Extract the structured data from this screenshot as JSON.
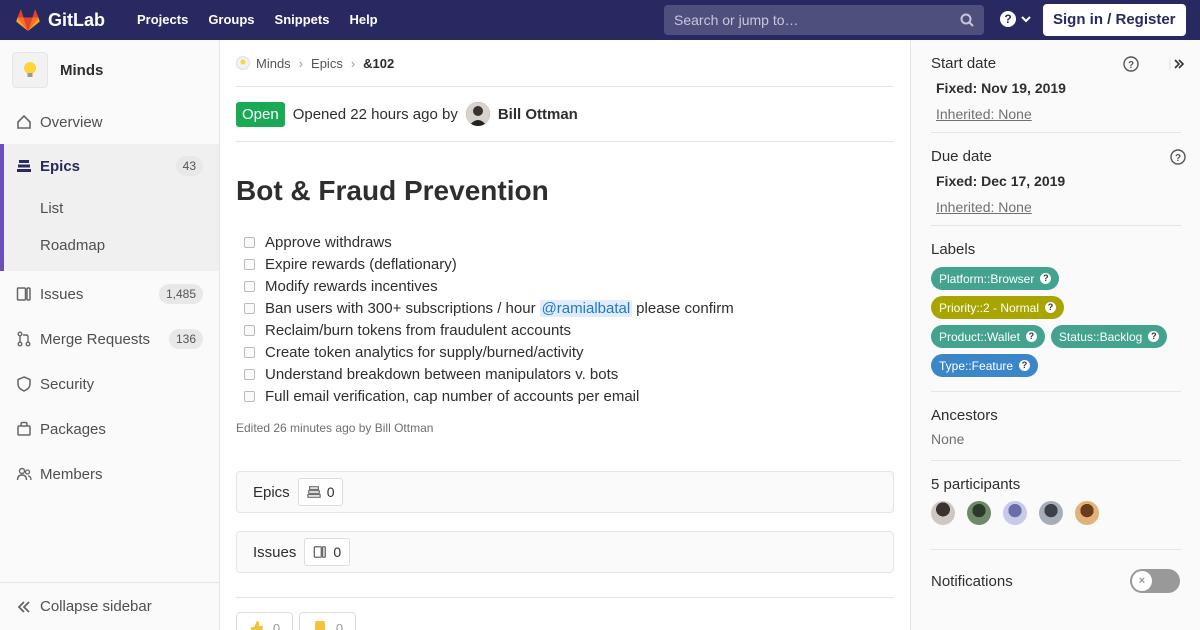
{
  "navbar": {
    "brand": "GitLab",
    "links": [
      "Projects",
      "Groups",
      "Snippets",
      "Help"
    ],
    "search_placeholder": "Search or jump to…",
    "signin": "Sign in / Register"
  },
  "sidebar": {
    "group_name": "Minds",
    "items": [
      {
        "label": "Overview"
      },
      {
        "label": "Epics",
        "count": "43"
      },
      {
        "label": "List"
      },
      {
        "label": "Roadmap"
      },
      {
        "label": "Issues",
        "count": "1,485"
      },
      {
        "label": "Merge Requests",
        "count": "136"
      },
      {
        "label": "Security"
      },
      {
        "label": "Packages"
      },
      {
        "label": "Members"
      }
    ],
    "collapse": "Collapse sidebar"
  },
  "breadcrumb": [
    "Minds",
    "Epics",
    "&102"
  ],
  "epic": {
    "status": "Open",
    "opened": "Opened 22 hours ago by",
    "author": "Bill Ottman",
    "title": "Bot & Fraud Prevention",
    "tasks": [
      "Approve withdraws",
      "Expire rewards (deflationary)",
      "Modify rewards incentives",
      "Ban users with 300+ subscriptions / hour",
      "Reclaim/burn tokens from fraudulent accounts",
      "Create token analytics for supply/burned/activity",
      "Understand breakdown between manipulators v. bots",
      "Full email verification, cap number of accounts per email"
    ],
    "mention": "@ramialbatal",
    "mention_suffix": "please confirm",
    "edited": "Edited 26 minutes ago by Bill Ottman"
  },
  "related": {
    "epics_label": "Epics",
    "epics_count": "0",
    "issues_label": "Issues",
    "issues_count": "0"
  },
  "awards": [
    "0",
    "0"
  ],
  "right_sidebar": {
    "start_date": {
      "title": "Start date",
      "fixed_label": "Fixed:",
      "fixed": "Nov 19, 2019",
      "inherited_label": "Inherited:",
      "inherited": "None"
    },
    "due_date": {
      "title": "Due date",
      "fixed_label": "Fixed:",
      "fixed": "Dec 17, 2019",
      "inherited_label": "Inherited:",
      "inherited": "None"
    },
    "labels_title": "Labels",
    "labels": [
      {
        "text": "Platform::Browser",
        "color": "#44a38f"
      },
      {
        "text": "Priority::2 - Normal",
        "color": "#a8a500"
      },
      {
        "text": "Product::Wallet",
        "color": "#44a38f"
      },
      {
        "text": "Status::Backlog",
        "color": "#44a38f"
      },
      {
        "text": "Type::Feature",
        "color": "#3a86c8"
      }
    ],
    "ancestors_title": "Ancestors",
    "ancestors_value": "None",
    "participants_title": "5 participants",
    "notifications_title": "Notifications"
  },
  "colors": {
    "navbar": "#292961",
    "accent": "#6b4fbb",
    "open": "#1aaa55"
  }
}
